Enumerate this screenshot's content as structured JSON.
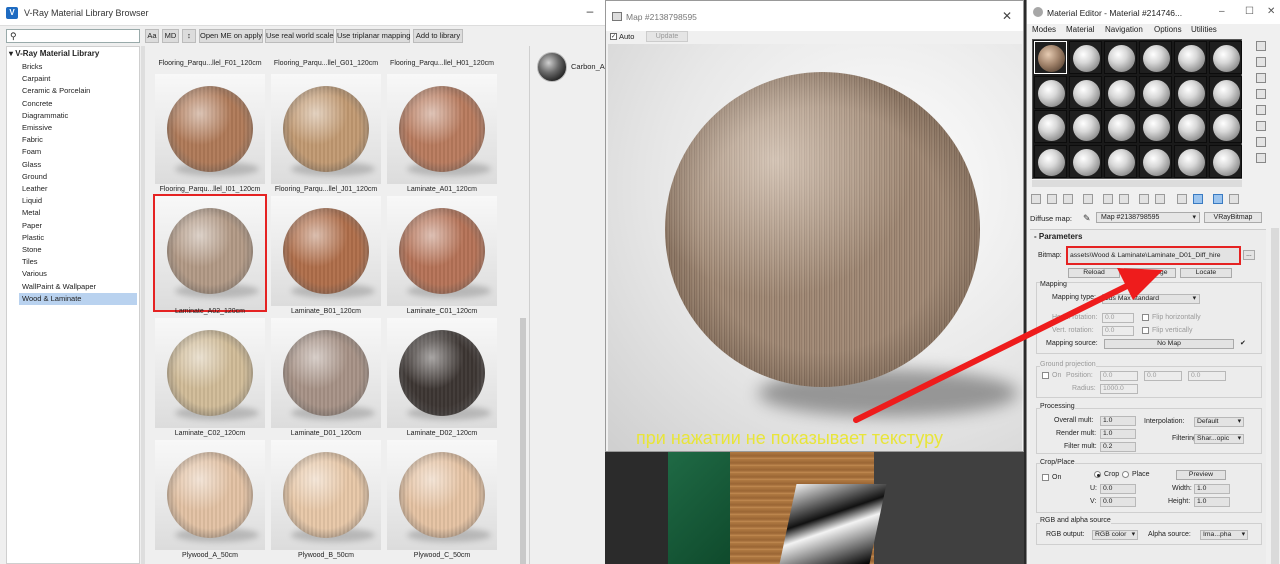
{
  "vray": {
    "title": "V-Ray Material Library Browser",
    "search_icon": "magnifier-icon",
    "toolbar": [
      "Aa",
      "MD",
      "↕",
      "Open ME on apply",
      "Use real world scale",
      "Use triplanar mapping",
      "Add to library"
    ],
    "tree_root": "V-Ray Material Library",
    "categories": [
      "Bricks",
      "Carpaint",
      "Ceramic & Porcelain",
      "Concrete",
      "Diagrammatic",
      "Emissive",
      "Fabric",
      "Foam",
      "Glass",
      "Ground",
      "Leather",
      "Liquid",
      "Metal",
      "Paper",
      "Plastic",
      "Stone",
      "Tiles",
      "Various",
      "WallPaint & Wallpaper",
      "Wood & Laminate"
    ],
    "selected_category": "Wood & Laminate",
    "top_labels": [
      "Flooring_Parqu...llel_F01_120cm",
      "Flooring_Parqu...llel_G01_120cm",
      "Flooring_Parqu...llel_H01_120cm"
    ],
    "materials": [
      {
        "name": "Flooring_Parqu...llel_I01_120cm",
        "color": "#b07a58"
      },
      {
        "name": "Flooring_Parqu...llel_J01_120cm",
        "color": "#c29a72"
      },
      {
        "name": "Laminate_A01_120cm",
        "color": "#b97b5e"
      },
      {
        "name": "Laminate_A02_120cm",
        "color": "#b39a86"
      },
      {
        "name": "Laminate_B01_120cm",
        "color": "#b06e4a"
      },
      {
        "name": "Laminate_C01_120cm",
        "color": "#b67357"
      },
      {
        "name": "Laminate_C02_120cm",
        "color": "#d1bc98"
      },
      {
        "name": "Laminate_D01_120cm",
        "color": "#a89387"
      },
      {
        "name": "Laminate_D02_120cm",
        "color": "#3d3633"
      },
      {
        "name": "Plywood_A_50cm",
        "color": "#e3c2a4"
      },
      {
        "name": "Plywood_B_50cm",
        "color": "#e8c8a8"
      },
      {
        "name": "Plywood_C_50cm",
        "color": "#e6c3a3"
      }
    ],
    "preview_label": "Carbon_Al"
  },
  "map": {
    "title": "Map #2138798595",
    "auto_label": "Auto",
    "update_label": "Update",
    "caption": "при нажатии не показывает текстуру"
  },
  "editor": {
    "title": "Material Editor - Material #214746...",
    "menu": [
      "Modes",
      "Material",
      "Navigation",
      "Options",
      "Utilities"
    ],
    "diffuse_label": "Diffuse map:",
    "diffuse_map": "Map #2138798595",
    "map_type": "VRayBitmap",
    "params_header": "Parameters",
    "bitmap_label": "Bitmap:",
    "bitmap_path": "assets\\Wood & Laminate\\Laminate_D01_Diff_hire",
    "bitmap_more": "...",
    "reload": "Reload",
    "view_image": "View image",
    "locate": "Locate",
    "mapping_header": "Mapping",
    "mapping_type_label": "Mapping type:",
    "mapping_type": "3ds Max standard",
    "horiz_rotation_label": "Horiz. rotation:",
    "horiz_rotation": "0.0",
    "vert_rotation_label": "Vert. rotation:",
    "vert_rotation": "0.0",
    "flip_h": "Flip horizontally",
    "flip_v": "Flip vertically",
    "mapping_source_label": "Mapping source:",
    "mapping_source": "No Map",
    "ground_header": "Ground projection",
    "on_label": "On",
    "position_label": "Position:",
    "pos_x": "0.0",
    "pos_y": "0.0",
    "pos_z": "0.0",
    "radius_label": "Radius:",
    "radius": "1000.0",
    "processing_header": "Processing",
    "overall_mult_label": "Overall mult:",
    "overall_mult": "1.0",
    "render_mult_label": "Render mult:",
    "render_mult": "1.0",
    "filter_mult_label": "Filter mult:",
    "filter_mult": "0.2",
    "interp_label": "Interpolation:",
    "interp": "Default",
    "filtering_label": "Filtering:",
    "filtering": "Shar...opic",
    "crop_header": "Crop/Place",
    "crop_on": "On",
    "crop": "Crop",
    "place": "Place",
    "preview": "Preview",
    "u_label": "U:",
    "u": "0.0",
    "v_label": "V:",
    "v": "0.0",
    "width_label": "Width:",
    "width": "1.0",
    "height_label": "Height:",
    "height": "1.0",
    "rgb_header": "RGB and alpha source",
    "rgb_output_label": "RGB output:",
    "rgb_output": "RGB color",
    "alpha_source_label": "Alpha source:",
    "alpha_source": "Ima...pha"
  },
  "colors": {
    "highlight": "#e52222",
    "caption": "#e8e53a",
    "selection": "#b9d2ef"
  }
}
